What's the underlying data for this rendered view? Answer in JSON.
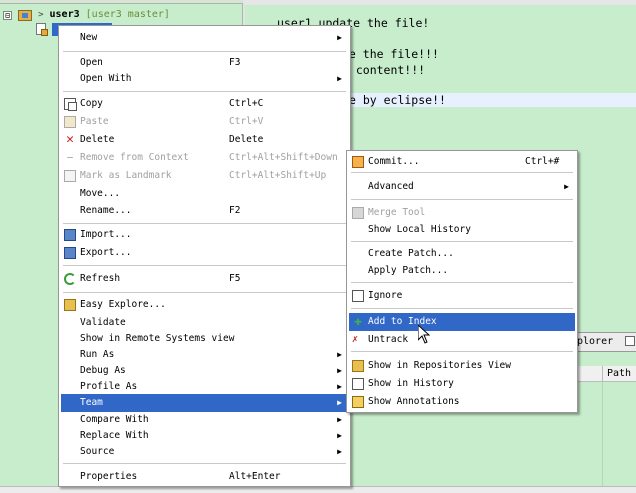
{
  "explorer": {
    "project_name": "user3",
    "project_branch": "[user3 master]",
    "expand_glyph": "⊟",
    "chevron": ">"
  },
  "editor": {
    "lines": [
      "user1 update the file!",
      "te the file!!!",
      "e content!!!",
      "e by eclipse!!"
    ]
  },
  "bottom_view": {
    "tab_label": "plorer",
    "column_path": "Path"
  },
  "main_menu": {
    "items": [
      {
        "label": "New",
        "accelerator": "",
        "submenu": true
      },
      {
        "label": "Open",
        "accelerator": "F3"
      },
      {
        "label": "Open With",
        "accelerator": "",
        "submenu": true
      },
      {
        "label": "Copy",
        "accelerator": "Ctrl+C",
        "icon": "copy-icon"
      },
      {
        "label": "Paste",
        "accelerator": "Ctrl+V",
        "icon": "paste-icon",
        "disabled": true
      },
      {
        "label": "Delete",
        "accelerator": "Delete",
        "icon": "delete-icon"
      },
      {
        "label": "Remove from Context",
        "accelerator": "Ctrl+Alt+Shift+Down",
        "icon": "remove-context-icon",
        "disabled": true
      },
      {
        "label": "Mark as Landmark",
        "accelerator": "Ctrl+Alt+Shift+Up",
        "icon": "landmark-icon",
        "disabled": true
      },
      {
        "label": "Move...",
        "accelerator": ""
      },
      {
        "label": "Rename...",
        "accelerator": "F2"
      },
      {
        "label": "Import...",
        "accelerator": "",
        "icon": "import-icon"
      },
      {
        "label": "Export...",
        "accelerator": "",
        "icon": "export-icon"
      },
      {
        "label": "Refresh",
        "accelerator": "F5",
        "icon": "refresh-icon"
      },
      {
        "label": "Easy Explore...",
        "accelerator": "",
        "icon": "folder-icon"
      },
      {
        "label": "Validate",
        "accelerator": ""
      },
      {
        "label": "Show in Remote Systems view",
        "accelerator": ""
      },
      {
        "label": "Run As",
        "accelerator": "",
        "submenu": true
      },
      {
        "label": "Debug As",
        "accelerator": "",
        "submenu": true
      },
      {
        "label": "Profile As",
        "accelerator": "",
        "submenu": true
      },
      {
        "label": "Team",
        "accelerator": "",
        "submenu": true,
        "active": true
      },
      {
        "label": "Compare With",
        "accelerator": "",
        "submenu": true
      },
      {
        "label": "Replace With",
        "accelerator": "",
        "submenu": true
      },
      {
        "label": "Source",
        "accelerator": "",
        "submenu": true
      },
      {
        "label": "Properties",
        "accelerator": "Alt+Enter"
      }
    ]
  },
  "team_menu": {
    "items": [
      {
        "label": "Commit...",
        "accelerator": "Ctrl+#",
        "icon": "commit-icon"
      },
      {
        "label": "Advanced",
        "accelerator": "",
        "submenu": true
      },
      {
        "label": "Merge Tool",
        "accelerator": "",
        "icon": "merge-tool-icon",
        "disabled": true
      },
      {
        "label": "Show Local History",
        "accelerator": ""
      },
      {
        "label": "Create Patch...",
        "accelerator": ""
      },
      {
        "label": "Apply Patch...",
        "accelerator": ""
      },
      {
        "label": "Ignore",
        "accelerator": "",
        "icon": "ignore-icon"
      },
      {
        "label": "Add to Index",
        "accelerator": "",
        "icon": "add-icon",
        "active": true
      },
      {
        "label": "Untrack",
        "accelerator": "",
        "icon": "untrack-icon"
      },
      {
        "label": "Show in Repositories View",
        "accelerator": "",
        "icon": "repositories-icon"
      },
      {
        "label": "Show in History",
        "accelerator": "",
        "icon": "history-icon"
      },
      {
        "label": "Show Annotations",
        "accelerator": "",
        "icon": "annotations-icon"
      }
    ]
  },
  "glyphs": {
    "submenu_arrow": "▶"
  },
  "colors": {
    "background": "#c7edcc",
    "selection": "#3168c8",
    "disabled_text": "#a0a0a0"
  }
}
